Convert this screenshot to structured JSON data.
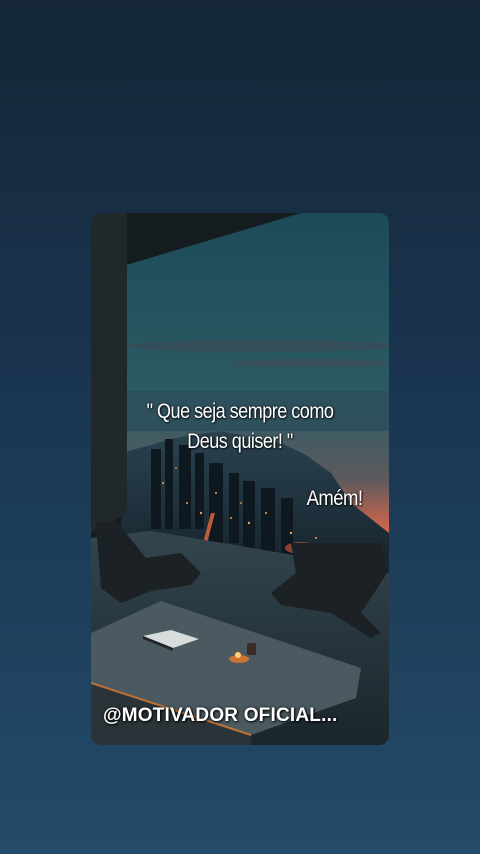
{
  "post": {
    "quote_line1": "\" Que seja sempre como",
    "quote_line2": "Deus quiser! \"",
    "closing": "Amém!",
    "watermark": "@MOTIVADOR OFICIAL..."
  },
  "colors": {
    "background_top": "#142638",
    "background_bottom": "#234b6a",
    "sky_top": "#1c4a56",
    "sunset": "#e0654a"
  }
}
